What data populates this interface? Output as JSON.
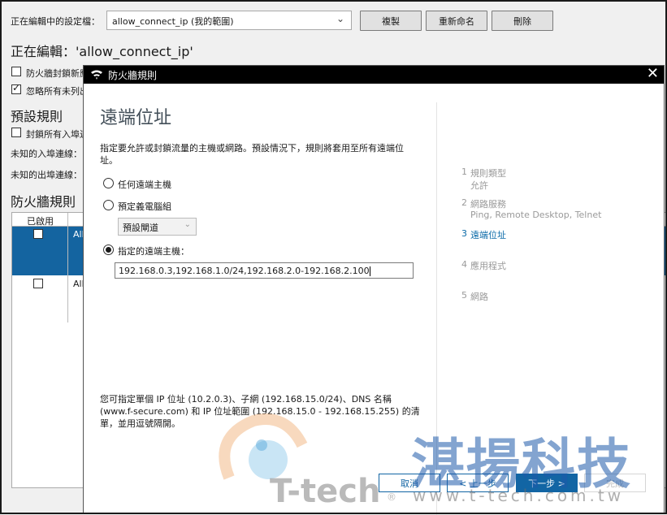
{
  "editor": {
    "profile_label": "正在編輯中的設定檔：",
    "profile_value": "allow_connect_ip (我的範圍)",
    "copy_button": "複製",
    "rename_button": "重新命名",
    "delete_button": "刪除",
    "editing_title": "正在編輯：'allow_connect_ip'",
    "opt_block_new": "防火牆封鎖新應",
    "opt_ignore": "忽略所有未列出",
    "default_rules_title": "預設規則",
    "opt_block_inbound": "封鎖所有入埠連",
    "unknown_inbound": "未知的入埠連線：",
    "unknown_outbound": "未知的出埠連線：",
    "firewall_rules_title": "防火牆規則",
    "col_enabled": "已啟用",
    "row1_text": "All",
    "row2_text": "All"
  },
  "dialog": {
    "title": "防火牆規則",
    "page_title": "遠端位址",
    "description": "指定要允許或封鎖流量的主機或網路。預設情況下，規則將套用至所有遠端位址。",
    "option_any": "任何遠端主機",
    "option_group": "預定義電腦組",
    "group_select_value": "預設閘道",
    "option_specific": "指定的遠端主機：",
    "ip_value": "192.168.0.3,192.168.1.0/24,192.168.2.0-192.168.2.100",
    "note": "您可指定單個 IP 位址 (10.2.0.3)、子網 (192.168.15.0/24)、DNS 名稱 (www.f-secure.com) 和 IP 位址範圍 (192.168.15.0 - 192.168.15.255) 的清單，並用逗號隔開。",
    "steps": [
      {
        "num": "1",
        "label": "規則類型",
        "sub": "允許"
      },
      {
        "num": "2",
        "label": "網路服務",
        "sub": "Ping, Remote Desktop, Telnet"
      },
      {
        "num": "3",
        "label": "遠端位址",
        "sub": ""
      },
      {
        "num": "4",
        "label": "應用程式",
        "sub": ""
      },
      {
        "num": "5",
        "label": "網路",
        "sub": ""
      }
    ],
    "active_step": 3,
    "cancel_button": "取消",
    "prev_button": "< 上一步",
    "next_button": "下一步 >",
    "finish_button": "完成"
  },
  "watermark": {
    "company": "湛揚科技",
    "url": "www.t-tech.com.tw",
    "brand": "T-tech",
    "reg": "®"
  },
  "colors": {
    "accent": "#1265a4",
    "selection": "#1464a0",
    "titlebar": "#000000"
  }
}
